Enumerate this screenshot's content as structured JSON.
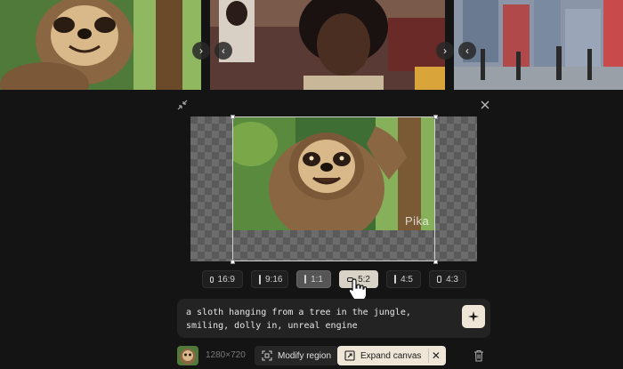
{
  "ratios": [
    {
      "label": "16:9"
    },
    {
      "label": "9:16"
    },
    {
      "label": "1:1"
    },
    {
      "label": "5:2"
    },
    {
      "label": "4:5"
    },
    {
      "label": "4:3"
    }
  ],
  "selected_ratio": "1:1",
  "hovered_ratio": "5:2",
  "watermark": "Pika",
  "prompt": {
    "text": "a sloth hanging from a tree in the jungle, smiling, dolly in, unreal engine"
  },
  "toolbar": {
    "resolution": "1280×720",
    "modify_label": "Modify region",
    "expand_label": "Expand canvas"
  },
  "colors": {
    "background": "#141414",
    "accent": "#efe6d8",
    "selected": "#555555"
  }
}
